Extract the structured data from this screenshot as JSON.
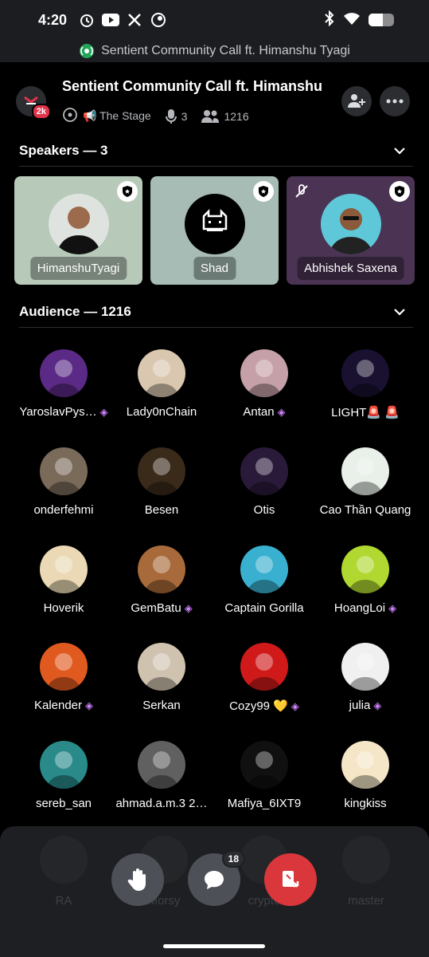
{
  "status_bar": {
    "time": "4:20",
    "battery_level": 0.55
  },
  "ongoing_banner": {
    "text": "Sentient Community Call ft. Himanshu Tyagi"
  },
  "header": {
    "title": "Sentient Community Call ft. Himanshu",
    "stage_badge": "2k",
    "stage_name": "📢 The Stage",
    "speaker_count": "3",
    "listener_count": "1216"
  },
  "speakers_section": {
    "title": "Speakers — 3",
    "items": [
      {
        "name": "HimanshuTyagi",
        "bg": "#b7c9b9"
      },
      {
        "name": "Shad",
        "bg": "#a7bcb5"
      },
      {
        "name": "Abhishek Saxena",
        "bg": "#4a3353"
      }
    ]
  },
  "audience_section": {
    "title": "Audience — 1216",
    "items": [
      {
        "name": "YaroslavPys…",
        "gem": "◈"
      },
      {
        "name": "Lady0nChain",
        "gem": ""
      },
      {
        "name": "Antan",
        "gem": "◈"
      },
      {
        "name": "LIGHT🚨 🚨",
        "gem": ""
      },
      {
        "name": "onderfehmi",
        "gem": ""
      },
      {
        "name": "Besen",
        "gem": ""
      },
      {
        "name": "Otis",
        "gem": ""
      },
      {
        "name": "Cao Thần Quang",
        "gem": ""
      },
      {
        "name": "Hoverik",
        "gem": ""
      },
      {
        "name": "GemBatu",
        "gem": "◈"
      },
      {
        "name": "Captain Gorilla",
        "gem": ""
      },
      {
        "name": "HoangLoi",
        "gem": "◈"
      },
      {
        "name": "Kalender",
        "gem": "◈"
      },
      {
        "name": "Serkan",
        "gem": ""
      },
      {
        "name": "Cozy99 💛",
        "gem": "◈"
      },
      {
        "name": "julia",
        "gem": "◈"
      },
      {
        "name": "sereb_san",
        "gem": ""
      },
      {
        "name": "ahmad.a.m.3 2…",
        "gem": ""
      },
      {
        "name": "Mafiya_6IXT9",
        "gem": ""
      },
      {
        "name": "kingkiss",
        "gem": ""
      }
    ]
  },
  "hidden_row": [
    "RA",
    "Morsy",
    "crypto",
    "master"
  ],
  "controls": {
    "chat_count": "18"
  }
}
